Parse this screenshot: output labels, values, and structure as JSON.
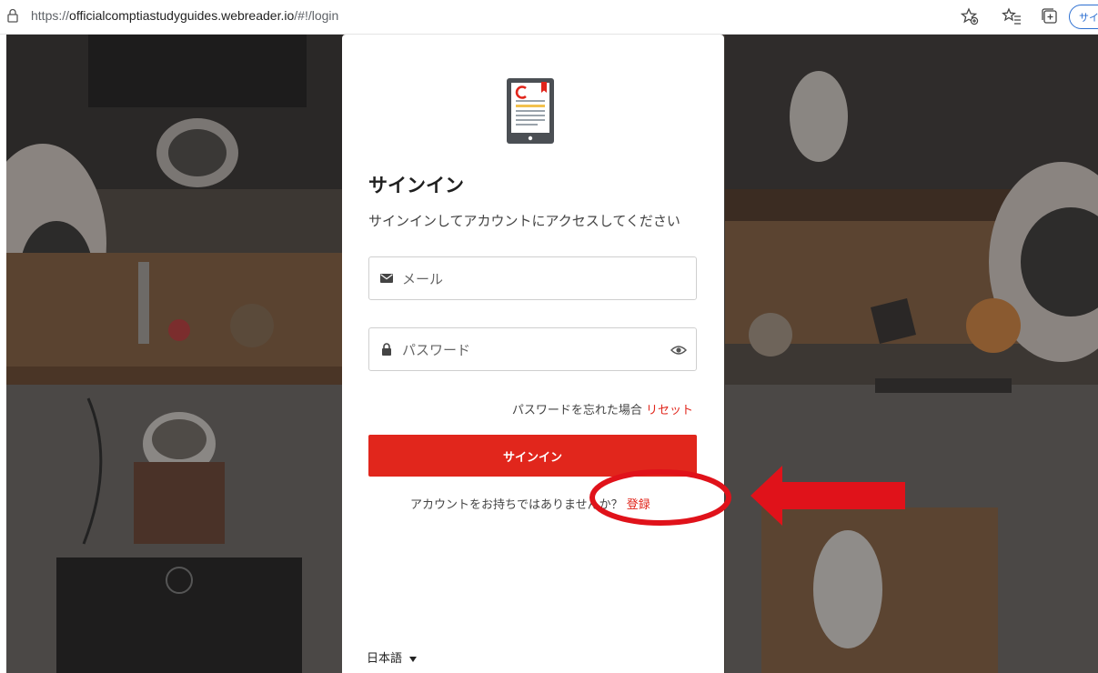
{
  "browser": {
    "url_prefix": "https://",
    "url_host": "officialcomptiastudyguides.webreader.io",
    "url_path": "/#!/login",
    "profile_button": "サイン"
  },
  "login": {
    "title": "サインイン",
    "subtitle": "サインインしてアカウントにアクセスしてください",
    "email_placeholder": "メール",
    "password_placeholder": "パスワード",
    "forgot_text": "パスワードを忘れた場合",
    "reset_link": "リセット",
    "submit_label": "サインイン",
    "no_account_text": "アカウントをお持ちではありませんか？",
    "register_link": "登録",
    "language": "日本語"
  },
  "icons": {
    "lock": "lock-icon",
    "email": "envelope-icon",
    "password": "padlock-icon",
    "show_password": "eye-icon",
    "logo": "ebook-tablet-icon"
  },
  "colors": {
    "accent": "#e1261c",
    "annotation": "#e0121a"
  }
}
